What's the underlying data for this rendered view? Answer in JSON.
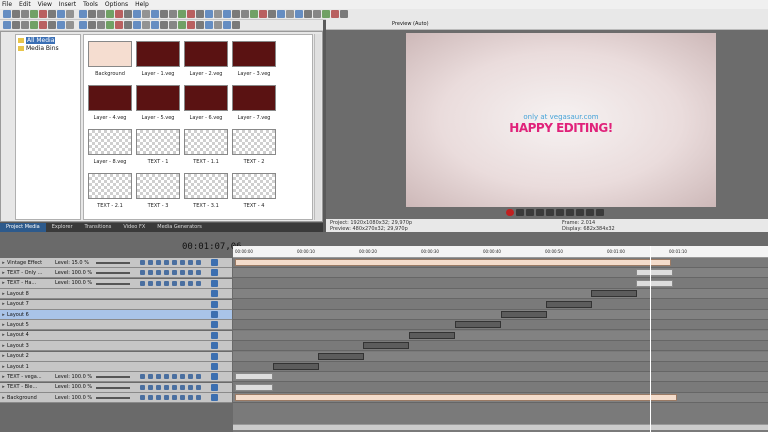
{
  "menu": [
    "File",
    "Edit",
    "View",
    "Insert",
    "Tools",
    "Options",
    "Help"
  ],
  "media_tree": [
    "All Media",
    "Media Bins"
  ],
  "media_items": [
    {
      "label": "Background",
      "kind": "peach"
    },
    {
      "label": "Layer - 1.veg",
      "kind": "dark"
    },
    {
      "label": "Layer - 2.veg",
      "kind": "dark"
    },
    {
      "label": "Layer - 3.veg",
      "kind": "dark"
    },
    {
      "label": "Layer - 4.veg",
      "kind": "dark"
    },
    {
      "label": "Layer - 5.veg",
      "kind": "dark"
    },
    {
      "label": "Layer - 6.veg",
      "kind": "dark"
    },
    {
      "label": "Layer - 7.veg",
      "kind": "dark"
    },
    {
      "label": "Layer - 8.veg",
      "kind": "checker"
    },
    {
      "label": "TEXT - 1",
      "kind": "checker"
    },
    {
      "label": "TEXT - 1.1",
      "kind": "checker"
    },
    {
      "label": "TEXT - 2",
      "kind": "checker"
    },
    {
      "label": "TEXT - 2.1",
      "kind": "checker"
    },
    {
      "label": "TEXT - 3",
      "kind": "checker"
    },
    {
      "label": "TEXT - 3.1",
      "kind": "checker"
    },
    {
      "label": "TEXT - 4",
      "kind": "checker"
    }
  ],
  "tabs": [
    "Project Media",
    "Explorer",
    "Transitions",
    "Video FX",
    "Media Generators"
  ],
  "preview": {
    "mode": "Preview (Auto)",
    "line1": "only at vegasaur.com",
    "line2": "HAPPY EDITING!",
    "project": "Project:   1920x1080x32; 29,970p",
    "preview_res": "Preview:   480x270x32; 29,970p",
    "frame": "Frame:       2.014",
    "display": "Display:    682x384x32"
  },
  "timecode": "00:01:07,06",
  "ruler_ticks": [
    "00:00:00",
    "00:00:10",
    "00:00:20",
    "00:00:30",
    "00:00:40",
    "00:00:50",
    "00:01:00",
    "00:01:10"
  ],
  "tracks": [
    {
      "name": "Vintage Effect",
      "level": "Level:  15.0 %",
      "sel": false
    },
    {
      "name": "TEXT - Only ...",
      "level": "Level: 100.0 %",
      "sel": false
    },
    {
      "name": "TEXT - Ha...",
      "level": "Level: 100.0 %",
      "sel": false
    },
    {
      "name": "Layout 8",
      "level": "",
      "sel": false
    },
    {
      "name": "Layout 7",
      "level": "",
      "sel": false
    },
    {
      "name": "Layout 6",
      "level": "",
      "sel": true
    },
    {
      "name": "Layout 5",
      "level": "",
      "sel": false
    },
    {
      "name": "Layout 4",
      "level": "",
      "sel": false
    },
    {
      "name": "Layout 3",
      "level": "",
      "sel": false
    },
    {
      "name": "Layout 2",
      "level": "",
      "sel": false
    },
    {
      "name": "Layout 1",
      "level": "",
      "sel": false
    },
    {
      "name": "TEXT - vega...",
      "level": "Level: 100.0 %",
      "sel": false
    },
    {
      "name": "TEXT - Ble...",
      "level": "Level: 100.0 %",
      "sel": false
    },
    {
      "name": "Background",
      "level": "Level: 100.0 %",
      "sel": false
    }
  ],
  "colors": {
    "accent": "#2d5a8c",
    "text_pink": "#e0227a",
    "text_blue": "#46a3d8"
  }
}
